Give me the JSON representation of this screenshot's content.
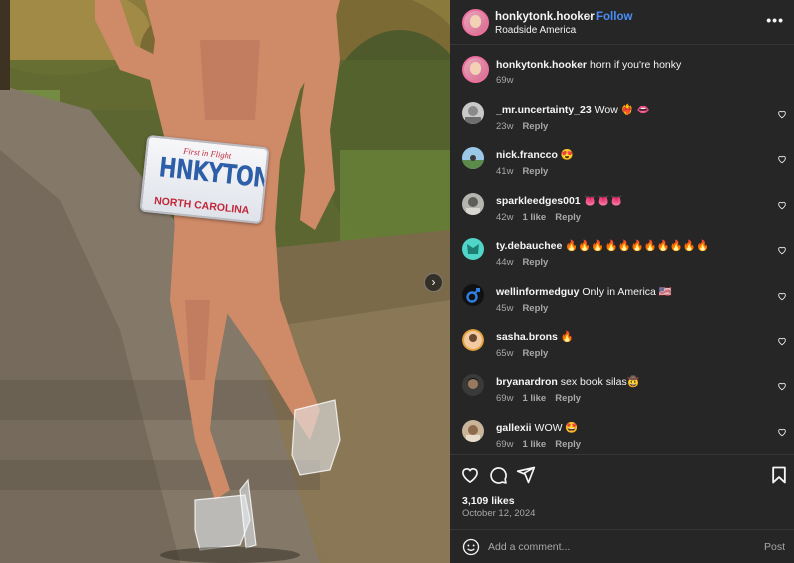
{
  "post": {
    "username": "honkytonk.hooker",
    "separator": "•",
    "follow_label": "Follow",
    "location": "Roadside America",
    "more_label": "•••",
    "caption": {
      "username": "honkytonk.hooker",
      "text": "horn if you're honky",
      "time": "69w"
    },
    "plate": {
      "top_text": "First in Flight",
      "main_text": "HNKYTONK",
      "bottom_text": "NORTH CAROLINA"
    },
    "carousel_next_label": "›"
  },
  "comments": [
    {
      "username": "_mr.uncertainty_23",
      "text": "Wow ❤️‍🔥 👄",
      "time": "23w",
      "likes": "",
      "reply": "Reply"
    },
    {
      "username": "nick.francco",
      "text": "😍",
      "time": "41w",
      "likes": "",
      "reply": "Reply"
    },
    {
      "username": "sparkleedges001",
      "text": "👅👅👅",
      "time": "42w",
      "likes": "1 like",
      "reply": "Reply"
    },
    {
      "username": "ty.debauchee",
      "text": "🔥🔥🔥🔥🔥🔥🔥🔥🔥🔥🔥",
      "time": "44w",
      "likes": "",
      "reply": "Reply"
    },
    {
      "username": "wellinformedguy",
      "text": "Only in America 🇺🇸",
      "time": "45w",
      "likes": "",
      "reply": "Reply"
    },
    {
      "username": "sasha.brons",
      "text": "🔥",
      "time": "65w",
      "likes": "",
      "reply": "Reply"
    },
    {
      "username": "bryanardron",
      "text": "sex book silas🤠",
      "time": "69w",
      "likes": "1 like",
      "reply": "Reply"
    },
    {
      "username": "gallexii",
      "text": "WOW 🤩",
      "time": "69w",
      "likes": "1 like",
      "reply": "Reply"
    }
  ],
  "stats": {
    "likes": "3,109 likes",
    "date": "October 12, 2024"
  },
  "add_comment": {
    "placeholder": "Add a comment...",
    "post_label": "Post"
  },
  "colors": {
    "panel_bg": "#262626",
    "accent_blue": "#4a8ff9",
    "muted_text": "#a8a8a8"
  },
  "icons": [
    "more-icon",
    "carousel-next-icon",
    "heart-icon",
    "comment-icon",
    "share-icon",
    "bookmark-icon",
    "emoji-icon"
  ]
}
